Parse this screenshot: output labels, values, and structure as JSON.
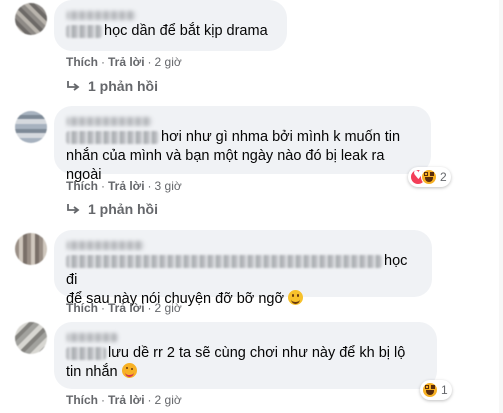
{
  "actions": {
    "like": "Thích",
    "reply": "Trả lời",
    "separator": "·"
  },
  "comments": [
    {
      "author": "Điểm",
      "text": "học dần để bắt kịp drama",
      "time": "2 giờ",
      "replies": "1 phản hồi"
    },
    {
      "author": "Hoàng Linh",
      "text_line1": "hơi như gì nhma bởi mình k muốn tin",
      "text_line2": "nhắn của mình và bạn một ngày nào đó bị leak ra ngoài",
      "time": "3 giờ",
      "reaction_count": "2",
      "replies": "1 phản hồi"
    },
    {
      "author": "Hương Giang",
      "text_line1": "học đi",
      "text_line2": "để sau này nói chuyện đỡ bỡ ngỡ",
      "time": "2 giờ"
    },
    {
      "author": "Trân Vy",
      "text_line1": "lưu dề rr 2 ta sẽ cùng chơi như này để kh bị lộ",
      "text_line2": "tin nhắn",
      "time": "2 giờ",
      "reaction_count": "1"
    }
  ],
  "icons": {
    "reply_arrow": "reply-arrow-icon",
    "heart": "heart-reaction-icon",
    "haha": "haha-reaction-icon",
    "smile": "smile-emoji-icon",
    "wink": "wink-emoji-icon"
  },
  "colors": {
    "bubble": "#f0f2f5",
    "meta": "#65676b",
    "text": "#050505"
  }
}
